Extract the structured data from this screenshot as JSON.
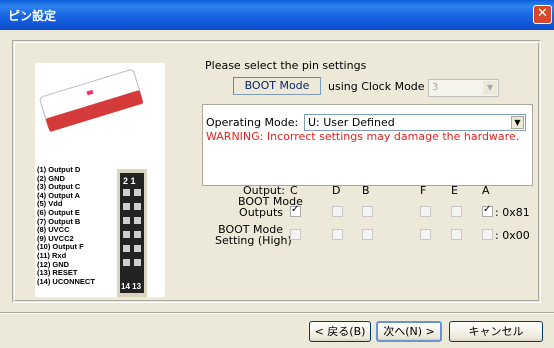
{
  "window": {
    "title": "ピン設定",
    "close_icon": "close-icon"
  },
  "intro": {
    "prompt": "Please select the pin settings",
    "boot_mode": "BOOT Mode",
    "clock_label": "using Clock Mode",
    "clock_value": "3"
  },
  "operating": {
    "label": "Operating Mode:",
    "value": "U: User Defined",
    "warning": "WARNING: Incorrect settings may damage the hardware."
  },
  "pins": {
    "row_output": "Output:",
    "row_boot_outputs": [
      "BOOT Mode",
      "Outputs"
    ],
    "row_boot_setting": [
      "BOOT Mode",
      "Setting (High)"
    ],
    "columns": [
      "C",
      "D",
      "B",
      "F",
      "E",
      "A"
    ],
    "outputs_checked": [
      true,
      false,
      false,
      false,
      false,
      true
    ],
    "setting_checked": [
      false,
      false,
      false,
      false,
      false,
      false
    ],
    "outputs_hex": ": 0x81",
    "setting_hex": ": 0x00"
  },
  "image": {
    "pin_list": [
      "(1) Output D",
      "(2) GND",
      "(3) Output C",
      "(4) Output A",
      "(5) Vdd",
      "(6) Output E",
      "(7) Output B",
      "(8) UVCC",
      "(9) UVCC2",
      "(10) Output F",
      "(11) Rxd",
      "(12) GND",
      "(13) RESET",
      "(14) UCONNECT"
    ],
    "connector_top": "2 1",
    "connector_bottom": "14 13",
    "brand_color": "#d43a3a"
  },
  "buttons": {
    "back": "< 戻る(B)",
    "next": "次へ(N) >",
    "cancel": "キャンセル"
  }
}
